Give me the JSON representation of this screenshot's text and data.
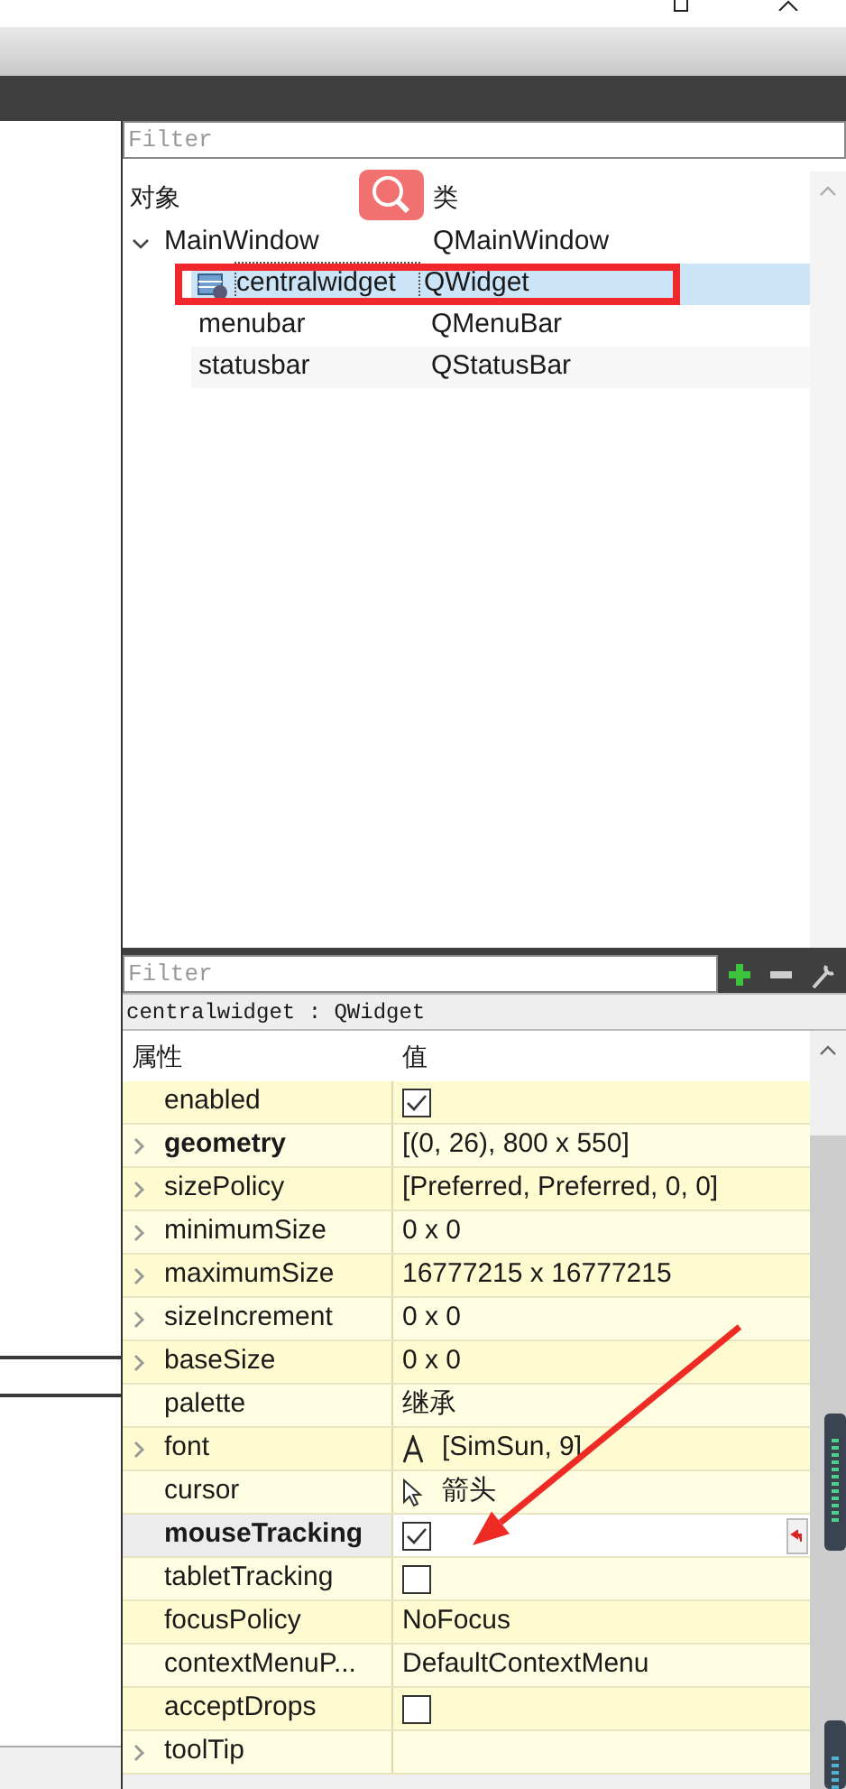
{
  "object_inspector": {
    "filter": {
      "placeholder": "Filter"
    },
    "columns": [
      "对象",
      "类"
    ],
    "tree": [
      {
        "name": "MainWindow",
        "class": "QMainWindow",
        "expanded": true,
        "selected": false,
        "children": [
          {
            "name": "centralwidget",
            "class": "QWidget",
            "selected": true
          },
          {
            "name": "menubar",
            "class": "QMenuBar",
            "selected": false
          },
          {
            "name": "statusbar",
            "class": "QStatusBar",
            "selected": false
          }
        ]
      }
    ]
  },
  "property_editor": {
    "filter": {
      "placeholder": "Filter"
    },
    "object_label": "centralwidget : QWidget",
    "columns": [
      "属性",
      "值"
    ],
    "properties": [
      {
        "name": "enabled",
        "kind": "check",
        "checked": true,
        "expandable": false,
        "bold": false,
        "selected": false
      },
      {
        "name": "geometry",
        "kind": "text",
        "value": "[(0, 26), 800 x 550]",
        "expandable": true,
        "bold": true,
        "selected": false
      },
      {
        "name": "sizePolicy",
        "kind": "text",
        "value": "[Preferred, Preferred, 0, 0]",
        "expandable": true,
        "bold": false,
        "selected": false
      },
      {
        "name": "minimumSize",
        "kind": "text",
        "value": "0 x 0",
        "expandable": true,
        "bold": false,
        "selected": false
      },
      {
        "name": "maximumSize",
        "kind": "text",
        "value": "16777215 x 16777215",
        "expandable": true,
        "bold": false,
        "selected": false
      },
      {
        "name": "sizeIncrement",
        "kind": "text",
        "value": "0 x 0",
        "expandable": true,
        "bold": false,
        "selected": false
      },
      {
        "name": "baseSize",
        "kind": "text",
        "value": "0 x 0",
        "expandable": true,
        "bold": false,
        "selected": false
      },
      {
        "name": "palette",
        "kind": "text",
        "value": "继承",
        "expandable": false,
        "bold": false,
        "selected": false
      },
      {
        "name": "font",
        "kind": "font",
        "value": "[SimSun, 9]",
        "expandable": true,
        "bold": false,
        "selected": false
      },
      {
        "name": "cursor",
        "kind": "cursor",
        "value": "箭头",
        "expandable": false,
        "bold": false,
        "selected": false
      },
      {
        "name": "mouseTracking",
        "kind": "check",
        "checked": true,
        "expandable": false,
        "bold": true,
        "selected": true
      },
      {
        "name": "tabletTracking",
        "kind": "check",
        "checked": false,
        "expandable": false,
        "bold": false,
        "selected": false
      },
      {
        "name": "focusPolicy",
        "kind": "text",
        "value": "NoFocus",
        "expandable": false,
        "bold": false,
        "selected": false
      },
      {
        "name": "contextMenuP...",
        "kind": "text",
        "value": "DefaultContextMenu",
        "expandable": false,
        "bold": false,
        "selected": false
      },
      {
        "name": "acceptDrops",
        "kind": "check",
        "checked": false,
        "expandable": false,
        "bold": false,
        "selected": false
      },
      {
        "name": "toolTip",
        "kind": "text",
        "expandable": true,
        "bold": false,
        "selected": false
      }
    ]
  }
}
